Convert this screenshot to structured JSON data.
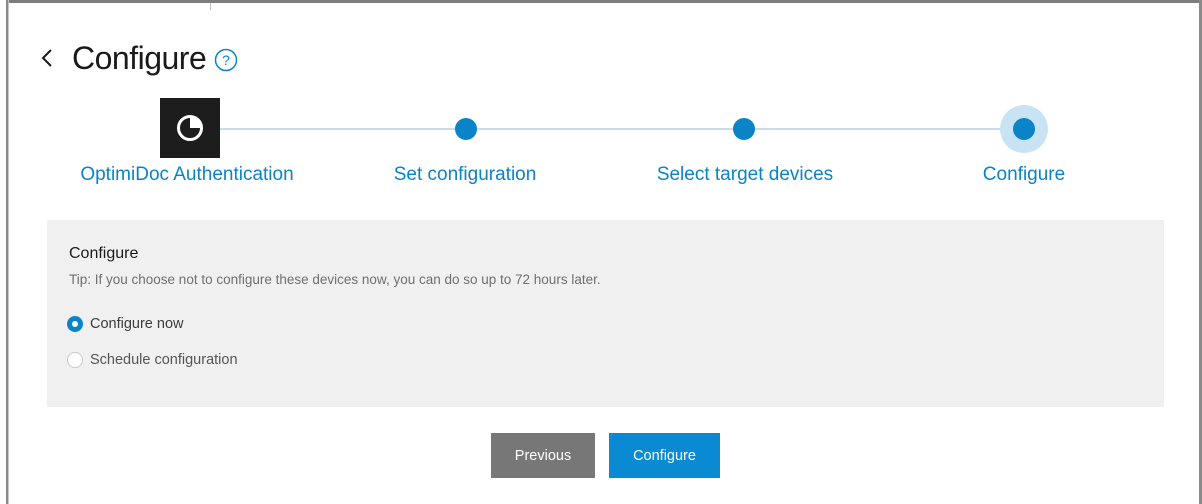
{
  "header": {
    "title": "Configure",
    "back_icon": "chevron-left-icon",
    "help_icon": "question-circle-icon"
  },
  "stepper": {
    "logo_icon": "pie-chart-logo-icon",
    "steps": [
      {
        "label": "OptimiDoc Authentication",
        "state": "completed"
      },
      {
        "label": "Set configuration",
        "state": "completed"
      },
      {
        "label": "Select target devices",
        "state": "completed"
      },
      {
        "label": "Configure",
        "state": "current"
      }
    ]
  },
  "panel": {
    "heading": "Configure",
    "tip": "Tip: If you choose not to configure these devices now, you can do so up to 72 hours later.",
    "options": [
      {
        "label": "Configure now",
        "selected": true
      },
      {
        "label": "Schedule configuration",
        "selected": false
      }
    ]
  },
  "buttons": {
    "previous": "Previous",
    "configure": "Configure"
  },
  "colors": {
    "accent": "#0a84c6",
    "line": "#c9dde9",
    "panel_bg": "#f0f0f0",
    "previous_bg": "#777777"
  }
}
